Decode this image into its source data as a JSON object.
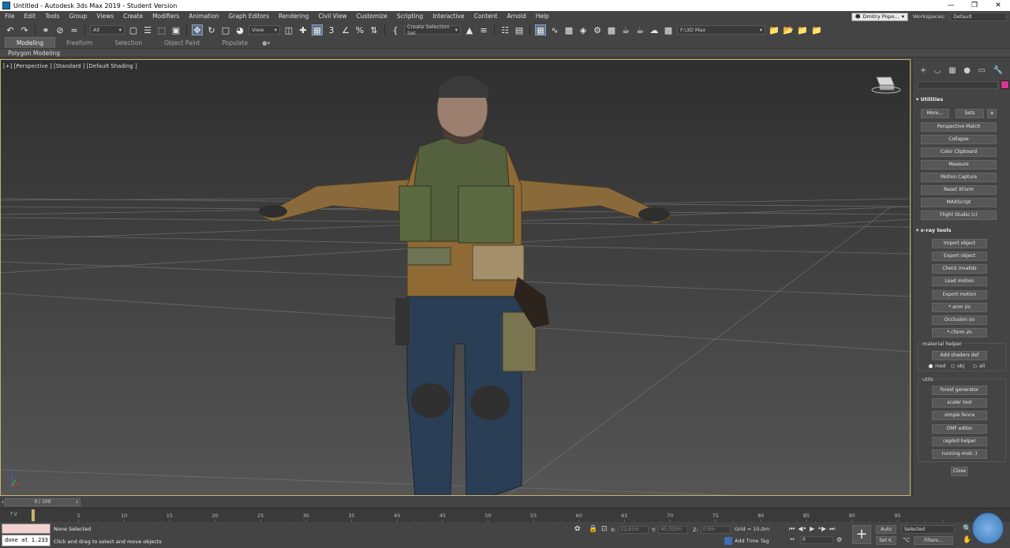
{
  "window": {
    "title": "Untitled - Autodesk 3ds Max 2019 - Student Version"
  },
  "menu": [
    "File",
    "Edit",
    "Tools",
    "Group",
    "Views",
    "Create",
    "Modifiers",
    "Animation",
    "Graph Editors",
    "Rendering",
    "Civil View",
    "Customize",
    "Scripting",
    "Interactive",
    "Content",
    "Arnold",
    "Help"
  ],
  "user": {
    "name": "Dmitry Popo...",
    "workspaces_label": "Workspaces:",
    "workspace": "Default"
  },
  "toolbar": {
    "selection_filter": "All",
    "ref_coord": "View",
    "named_selection": "Create Selection Set",
    "project_path": "F:\\3D Max"
  },
  "ribbon": {
    "tabs": [
      "Modeling",
      "Freeform",
      "Selection",
      "Object Paint",
      "Populate"
    ],
    "active_tab": "Modeling",
    "subpanel": "Polygon Modeling"
  },
  "viewport": {
    "label": "[+] [Perspective ] [Standard ] [Default Shading ]"
  },
  "command_panel": {
    "utilities": {
      "title": "Utilities",
      "more": "More...",
      "sets": "Sets",
      "buttons": [
        "Perspective Match",
        "Collapse",
        "Color Clipboard",
        "Measure",
        "Motion Capture",
        "Reset XForm",
        "MAXScript",
        "Flight Studio (c)"
      ]
    },
    "xray": {
      "title": "x-ray tools",
      "buttons": [
        "Import object",
        "Export object",
        "Check invalids",
        "Load motion",
        "Export motion",
        "*.anm i/o",
        "Occlusion i/o",
        "*.cform i/o"
      ],
      "material_helper": {
        "label": "material helper",
        "button": "Add shaders def",
        "radios": [
          {
            "label": "med",
            "checked": true
          },
          {
            "label": "obj",
            "checked": false
          },
          {
            "label": "all",
            "checked": false
          }
        ]
      },
      "utils": {
        "label": "utils",
        "buttons": [
          "forest generator",
          "scaler tool",
          "simple fence",
          "OMF editor",
          "ragdoll helper",
          "running mob :)"
        ]
      },
      "close": "Close"
    }
  },
  "timeline": {
    "slider": "0 / 100",
    "ticks": [
      "5",
      "10",
      "15",
      "20",
      "25",
      "30",
      "35",
      "40",
      "45",
      "50",
      "55",
      "60",
      "65",
      "70",
      "75",
      "80",
      "85",
      "90",
      "95"
    ]
  },
  "status": {
    "maxscript_output": "done at 1.233",
    "selection": "None Selected",
    "prompt": "Click and drag to select and move objects",
    "x_label": "X:",
    "x": "22,61m",
    "y_label": "Y:",
    "y": "40,702m",
    "z_label": "Z:",
    "z": "0,0m",
    "grid": "Grid = 10,0m",
    "add_time_tag": "Add Time Tag",
    "frame": "0",
    "auto_key": "Auto",
    "set_key": "Set K.",
    "key_filter": "Selected",
    "filters": "Filters..."
  },
  "colors": {
    "accent": "#5a6d85",
    "viewport_border": "#c9b46a",
    "object_color": "#d8378f"
  }
}
